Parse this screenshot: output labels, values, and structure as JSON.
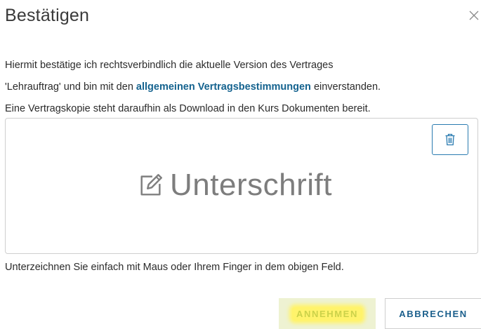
{
  "dialog": {
    "title": "Bestätigen",
    "close_icon": "close-icon"
  },
  "body": {
    "line1": "Hiermit bestätige ich rechtsverbindlich die aktuelle Version des Vertrages",
    "line2_before": "'Lehrauftrag' und bin mit den ",
    "line2_link": "allgemeinen Vertragsbestimmungen",
    "line2_after": " einverstanden.",
    "line3": "Eine Vertragskopie steht daraufhin als Download in den Kurs Dokumenten bereit."
  },
  "signature": {
    "placeholder": "Unterschrift",
    "placeholder_icon": "edit-icon",
    "clear_icon": "trash-icon",
    "hint": "Unterzeichnen Sie einfach mit Maus oder Ihrem Finger in dem obigen Feld."
  },
  "actions": {
    "accept_label": "ANNEHMEN",
    "cancel_label": "ABBRECHEN"
  },
  "colors": {
    "link": "#15638f",
    "accent_border": "#2a7bb0",
    "highlight": "#fff36b"
  }
}
